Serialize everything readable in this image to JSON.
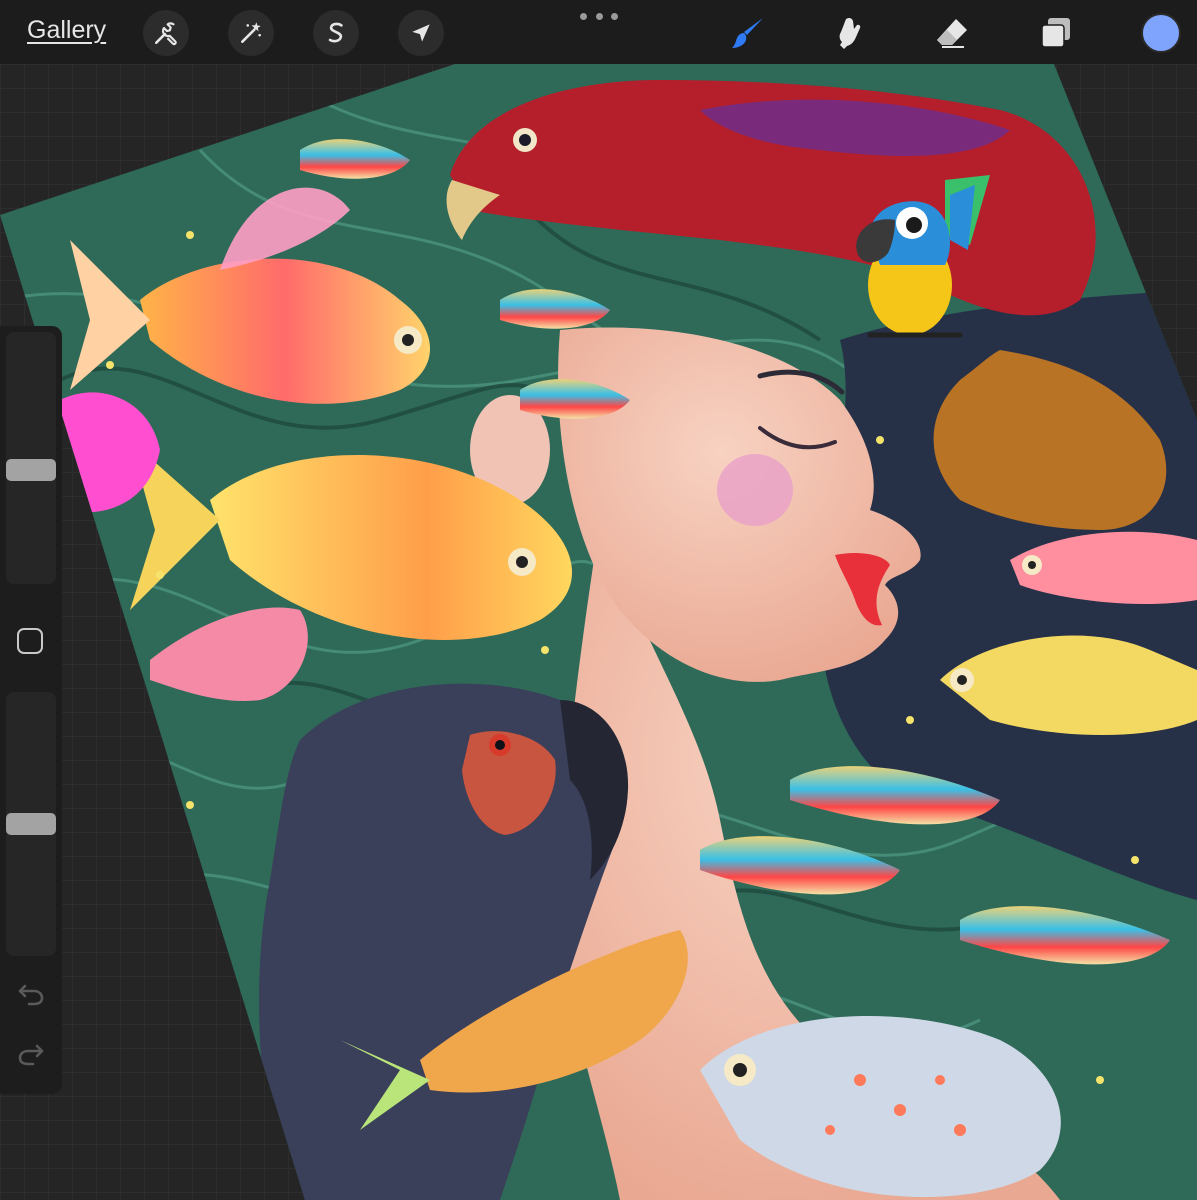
{
  "topbar": {
    "gallery_label": "Gallery",
    "left_tools": [
      {
        "name": "actions",
        "icon": "wrench-icon"
      },
      {
        "name": "adjustments",
        "icon": "magic-wand-icon"
      },
      {
        "name": "selection",
        "icon": "selection-s-icon"
      },
      {
        "name": "transform",
        "icon": "arrow-cursor-icon"
      }
    ],
    "more_icon": "more-dots-icon",
    "right_tools": [
      {
        "name": "brush",
        "icon": "brush-icon",
        "active": true
      },
      {
        "name": "smudge",
        "icon": "smudge-icon",
        "active": false
      },
      {
        "name": "eraser",
        "icon": "eraser-icon",
        "active": false
      },
      {
        "name": "layers",
        "icon": "layers-icon",
        "active": false
      }
    ],
    "current_color": "#7fa4fd",
    "accent_color": "#2f7bf5"
  },
  "sidebar": {
    "brush_size": 0.45,
    "brush_opacity": 0.5,
    "modify_icon": "square-icon",
    "undo_icon": "undo-icon",
    "redo_icon": "redo-icon"
  },
  "artwork": {
    "hair_color": "#2f6a58",
    "skin_color": "#f3c1ae",
    "night_color": "#263148",
    "red_bird_color": "#b51f2c",
    "black_bird_color": "#3a3f5a"
  }
}
